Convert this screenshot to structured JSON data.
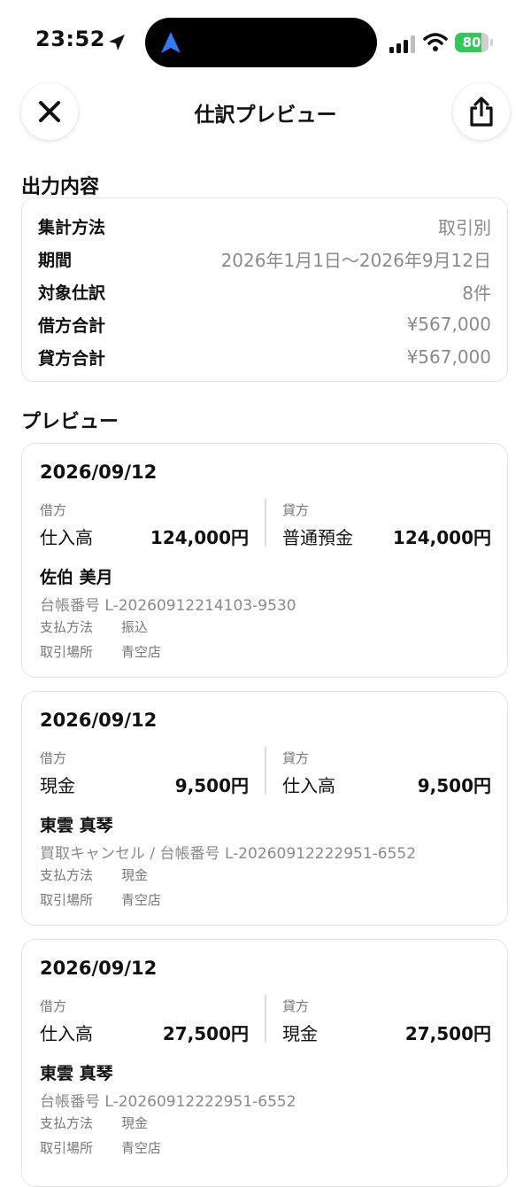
{
  "status_bar": {
    "time": "23:52",
    "battery": "80",
    "battery_level": 0.8
  },
  "nav": {
    "title": "仕訳プレビュー"
  },
  "output": {
    "section_title": "出力内容",
    "rows": [
      {
        "label": "集計方法",
        "value": "取引別"
      },
      {
        "label": "期間",
        "value": "2026年1月1日〜2026年9月12日"
      },
      {
        "label": "対象仕訳",
        "value": "8件"
      },
      {
        "label": "借方合計",
        "value": "¥567,000"
      },
      {
        "label": "貸方合計",
        "value": "¥567,000"
      }
    ]
  },
  "preview": {
    "section_title": "プレビュー",
    "entries": [
      {
        "date": "2026/09/12",
        "debit_label": "借方",
        "debit_account": "仕入高",
        "debit_amount": "124,000円",
        "credit_label": "貸方",
        "credit_account": "普通預金",
        "credit_amount": "124,000円",
        "person": "佐伯 美月",
        "memo": "台帳番号 L-20260912214103-9530",
        "payment_label": "支払方法",
        "payment_value": "振込",
        "place_label": "取引場所",
        "place_value": "青空店"
      },
      {
        "date": "2026/09/12",
        "debit_label": "借方",
        "debit_account": "現金",
        "debit_amount": "9,500円",
        "credit_label": "貸方",
        "credit_account": "仕入高",
        "credit_amount": "9,500円",
        "person": "東雲 真琴",
        "memo": "買取キャンセル / 台帳番号 L-20260912222951-6552",
        "payment_label": "支払方法",
        "payment_value": "現金",
        "place_label": "取引場所",
        "place_value": "青空店"
      },
      {
        "date": "2026/09/12",
        "debit_label": "借方",
        "debit_account": "仕入高",
        "debit_amount": "27,500円",
        "credit_label": "貸方",
        "credit_account": "現金",
        "credit_amount": "27,500円",
        "person": "東雲 真琴",
        "memo": "台帳番号 L-20260912222951-6552",
        "payment_label": "支払方法",
        "payment_value": "現金",
        "place_label": "取引場所",
        "place_value": "青空店"
      }
    ]
  },
  "colors": {
    "accent_blue": "#2f7cf6",
    "battery_green": "#34c759"
  }
}
